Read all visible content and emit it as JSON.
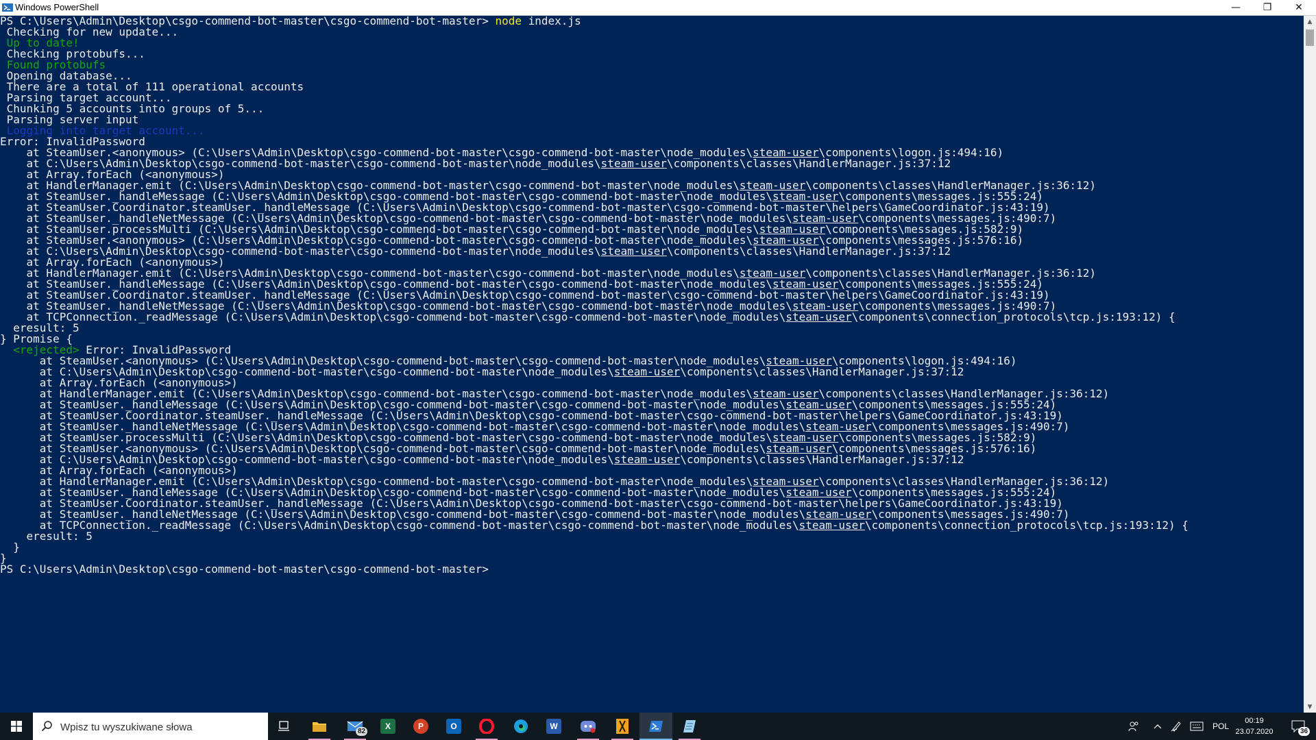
{
  "window": {
    "title": "Windows PowerShell",
    "controls": {
      "minimize": "—",
      "restore": "❐",
      "close": "✕"
    }
  },
  "console": {
    "lines": [
      [
        {
          "t": "PS C:\\Users\\Admin\\Desktop\\csgo-commend-bot-master\\csgo-commend-bot-master> ",
          "c": "gray"
        },
        {
          "t": "node",
          "c": "yellow"
        },
        {
          "t": " index.js",
          "c": "gray"
        }
      ],
      [
        {
          "t": " Checking for new update...",
          "c": "gray"
        }
      ],
      [
        {
          "t": " Up to date!",
          "c": "green"
        }
      ],
      [
        {
          "t": " Checking protobufs...",
          "c": "gray"
        }
      ],
      [
        {
          "t": " Found protobufs",
          "c": "green"
        }
      ],
      [
        {
          "t": " Opening database...",
          "c": "gray"
        }
      ],
      [
        {
          "t": " There are a total of 111 operational accounts",
          "c": "gray"
        }
      ],
      [
        {
          "t": " Parsing target account...",
          "c": "gray"
        }
      ],
      [
        {
          "t": " Chunking 5 accounts into groups of 5...",
          "c": "gray"
        }
      ],
      [
        {
          "t": " Parsing server input",
          "c": "gray"
        }
      ],
      [
        {
          "t": " Logging into target account...",
          "c": "blue"
        }
      ],
      [
        {
          "t": "Error: InvalidPassword",
          "c": "gray"
        }
      ],
      [
        {
          "t": "    at SteamUser.<anonymous> (C:\\Users\\Admin\\Desktop\\csgo-commend-bot-master\\csgo-commend-bot-master\\node_modules\\",
          "c": "gray"
        },
        {
          "t": "steam-user",
          "c": "gray",
          "u": true
        },
        {
          "t": "\\components\\logon.js:494:16)",
          "c": "gray"
        }
      ],
      [
        {
          "t": "    at C:\\Users\\Admin\\Desktop\\csgo-commend-bot-master\\csgo-commend-bot-master\\node_modules\\",
          "c": "gray"
        },
        {
          "t": "steam-user",
          "c": "gray",
          "u": true
        },
        {
          "t": "\\components\\classes\\HandlerManager.js:37:12",
          "c": "gray"
        }
      ],
      [
        {
          "t": "    at Array.forEach (<anonymous>)",
          "c": "gray"
        }
      ],
      [
        {
          "t": "    at HandlerManager.emit (C:\\Users\\Admin\\Desktop\\csgo-commend-bot-master\\csgo-commend-bot-master\\node_modules\\",
          "c": "gray"
        },
        {
          "t": "steam-user",
          "c": "gray",
          "u": true
        },
        {
          "t": "\\components\\classes\\HandlerManager.js:36:12)",
          "c": "gray"
        }
      ],
      [
        {
          "t": "    at SteamUser._handleMessage (C:\\Users\\Admin\\Desktop\\csgo-commend-bot-master\\csgo-commend-bot-master\\node_modules\\",
          "c": "gray"
        },
        {
          "t": "steam-user",
          "c": "gray",
          "u": true
        },
        {
          "t": "\\components\\messages.js:555:24)",
          "c": "gray"
        }
      ],
      [
        {
          "t": "    at SteamUser.Coordinator.steamUser._handleMessage (C:\\Users\\Admin\\Desktop\\csgo-commend-bot-master\\csgo-commend-bot-master\\helpers\\GameCoordinator.js:43:19)",
          "c": "gray"
        }
      ],
      [
        {
          "t": "    at SteamUser._handleNetMessage (C:\\Users\\Admin\\Desktop\\csgo-commend-bot-master\\csgo-commend-bot-master\\node_modules\\",
          "c": "gray"
        },
        {
          "t": "steam-user",
          "c": "gray",
          "u": true
        },
        {
          "t": "\\components\\messages.js:490:7)",
          "c": "gray"
        }
      ],
      [
        {
          "t": "    at SteamUser.processMulti (C:\\Users\\Admin\\Desktop\\csgo-commend-bot-master\\csgo-commend-bot-master\\node_modules\\",
          "c": "gray"
        },
        {
          "t": "steam-user",
          "c": "gray",
          "u": true
        },
        {
          "t": "\\components\\messages.js:582:9)",
          "c": "gray"
        }
      ],
      [
        {
          "t": "    at SteamUser.<anonymous> (C:\\Users\\Admin\\Desktop\\csgo-commend-bot-master\\csgo-commend-bot-master\\node_modules\\",
          "c": "gray"
        },
        {
          "t": "steam-user",
          "c": "gray",
          "u": true
        },
        {
          "t": "\\components\\messages.js:576:16)",
          "c": "gray"
        }
      ],
      [
        {
          "t": "    at C:\\Users\\Admin\\Desktop\\csgo-commend-bot-master\\csgo-commend-bot-master\\node_modules\\",
          "c": "gray"
        },
        {
          "t": "steam-user",
          "c": "gray",
          "u": true
        },
        {
          "t": "\\components\\classes\\HandlerManager.js:37:12",
          "c": "gray"
        }
      ],
      [
        {
          "t": "    at Array.forEach (<anonymous>)",
          "c": "gray"
        }
      ],
      [
        {
          "t": "    at HandlerManager.emit (C:\\Users\\Admin\\Desktop\\csgo-commend-bot-master\\csgo-commend-bot-master\\node_modules\\",
          "c": "gray"
        },
        {
          "t": "steam-user",
          "c": "gray",
          "u": true
        },
        {
          "t": "\\components\\classes\\HandlerManager.js:36:12)",
          "c": "gray"
        }
      ],
      [
        {
          "t": "    at SteamUser._handleMessage (C:\\Users\\Admin\\Desktop\\csgo-commend-bot-master\\csgo-commend-bot-master\\node_modules\\",
          "c": "gray"
        },
        {
          "t": "steam-user",
          "c": "gray",
          "u": true
        },
        {
          "t": "\\components\\messages.js:555:24)",
          "c": "gray"
        }
      ],
      [
        {
          "t": "    at SteamUser.Coordinator.steamUser._handleMessage (C:\\Users\\Admin\\Desktop\\csgo-commend-bot-master\\csgo-commend-bot-master\\helpers\\GameCoordinator.js:43:19)",
          "c": "gray"
        }
      ],
      [
        {
          "t": "    at SteamUser._handleNetMessage (C:\\Users\\Admin\\Desktop\\csgo-commend-bot-master\\csgo-commend-bot-master\\node_modules\\",
          "c": "gray"
        },
        {
          "t": "steam-user",
          "c": "gray",
          "u": true
        },
        {
          "t": "\\components\\messages.js:490:7)",
          "c": "gray"
        }
      ],
      [
        {
          "t": "    at TCPConnection._readMessage (C:\\Users\\Admin\\Desktop\\csgo-commend-bot-master\\csgo-commend-bot-master\\node_modules\\",
          "c": "gray"
        },
        {
          "t": "steam-user",
          "c": "gray",
          "u": true
        },
        {
          "t": "\\components\\connection_protocols\\tcp.js:193:12) {",
          "c": "gray"
        }
      ],
      [
        {
          "t": "  eresult: 5",
          "c": "gray"
        }
      ],
      [
        {
          "t": "} Promise {",
          "c": "gray"
        }
      ],
      [
        {
          "t": "  ",
          "c": "gray"
        },
        {
          "t": "<rejected>",
          "c": "green"
        },
        {
          "t": " Error: InvalidPassword",
          "c": "gray"
        }
      ],
      [
        {
          "t": "      at SteamUser.<anonymous> (C:\\Users\\Admin\\Desktop\\csgo-commend-bot-master\\csgo-commend-bot-master\\node_modules\\",
          "c": "gray"
        },
        {
          "t": "steam-user",
          "c": "gray",
          "u": true
        },
        {
          "t": "\\components\\logon.js:494:16)",
          "c": "gray"
        }
      ],
      [
        {
          "t": "      at C:\\Users\\Admin\\Desktop\\csgo-commend-bot-master\\csgo-commend-bot-master\\node_modules\\",
          "c": "gray"
        },
        {
          "t": "steam-user",
          "c": "gray",
          "u": true
        },
        {
          "t": "\\components\\classes\\HandlerManager.js:37:12",
          "c": "gray"
        }
      ],
      [
        {
          "t": "      at Array.forEach (<anonymous>)",
          "c": "gray"
        }
      ],
      [
        {
          "t": "      at HandlerManager.emit (C:\\Users\\Admin\\Desktop\\csgo-commend-bot-master\\csgo-commend-bot-master\\node_modules\\",
          "c": "gray"
        },
        {
          "t": "steam-user",
          "c": "gray",
          "u": true
        },
        {
          "t": "\\components\\classes\\HandlerManager.js:36:12)",
          "c": "gray"
        }
      ],
      [
        {
          "t": "      at SteamUser._handleMessage (C:\\Users\\Admin\\Desktop\\csgo-commend-bot-master\\csgo-commend-bot-master\\node_modules\\",
          "c": "gray"
        },
        {
          "t": "steam-user",
          "c": "gray",
          "u": true
        },
        {
          "t": "\\components\\messages.js:555:24)",
          "c": "gray"
        }
      ],
      [
        {
          "t": "      at SteamUser.Coordinator.steamUser._handleMessage (C:\\Users\\Admin\\Desktop\\csgo-commend-bot-master\\csgo-commend-bot-master\\helpers\\GameCoordinator.js:43:19)",
          "c": "gray"
        }
      ],
      [
        {
          "t": "      at SteamUser._handleNetMessage (C:\\Users\\Admin\\Desktop\\csgo-commend-bot-master\\csgo-commend-bot-master\\node_modules\\",
          "c": "gray"
        },
        {
          "t": "steam-user",
          "c": "gray",
          "u": true
        },
        {
          "t": "\\components\\messages.js:490:7)",
          "c": "gray"
        }
      ],
      [
        {
          "t": "      at SteamUser.processMulti (C:\\Users\\Admin\\Desktop\\csgo-commend-bot-master\\csgo-commend-bot-master\\node_modules\\",
          "c": "gray"
        },
        {
          "t": "steam-user",
          "c": "gray",
          "u": true
        },
        {
          "t": "\\components\\messages.js:582:9)",
          "c": "gray"
        }
      ],
      [
        {
          "t": "      at SteamUser.<anonymous> (C:\\Users\\Admin\\Desktop\\csgo-commend-bot-master\\csgo-commend-bot-master\\node_modules\\",
          "c": "gray"
        },
        {
          "t": "steam-user",
          "c": "gray",
          "u": true
        },
        {
          "t": "\\components\\messages.js:576:16)",
          "c": "gray"
        }
      ],
      [
        {
          "t": "      at C:\\Users\\Admin\\Desktop\\csgo-commend-bot-master\\csgo-commend-bot-master\\node_modules\\",
          "c": "gray"
        },
        {
          "t": "steam-user",
          "c": "gray",
          "u": true
        },
        {
          "t": "\\components\\classes\\HandlerManager.js:37:12",
          "c": "gray"
        }
      ],
      [
        {
          "t": "      at Array.forEach (<anonymous>)",
          "c": "gray"
        }
      ],
      [
        {
          "t": "      at HandlerManager.emit (C:\\Users\\Admin\\Desktop\\csgo-commend-bot-master\\csgo-commend-bot-master\\node_modules\\",
          "c": "gray"
        },
        {
          "t": "steam-user",
          "c": "gray",
          "u": true
        },
        {
          "t": "\\components\\classes\\HandlerManager.js:36:12)",
          "c": "gray"
        }
      ],
      [
        {
          "t": "      at SteamUser._handleMessage (C:\\Users\\Admin\\Desktop\\csgo-commend-bot-master\\csgo-commend-bot-master\\node_modules\\",
          "c": "gray"
        },
        {
          "t": "steam-user",
          "c": "gray",
          "u": true
        },
        {
          "t": "\\components\\messages.js:555:24)",
          "c": "gray"
        }
      ],
      [
        {
          "t": "      at SteamUser.Coordinator.steamUser._handleMessage (C:\\Users\\Admin\\Desktop\\csgo-commend-bot-master\\csgo-commend-bot-master\\helpers\\GameCoordinator.js:43:19)",
          "c": "gray"
        }
      ],
      [
        {
          "t": "      at SteamUser._handleNetMessage (C:\\Users\\Admin\\Desktop\\csgo-commend-bot-master\\csgo-commend-bot-master\\node_modules\\",
          "c": "gray"
        },
        {
          "t": "steam-user",
          "c": "gray",
          "u": true
        },
        {
          "t": "\\components\\messages.js:490:7)",
          "c": "gray"
        }
      ],
      [
        {
          "t": "      at TCPConnection._readMessage (C:\\Users\\Admin\\Desktop\\csgo-commend-bot-master\\csgo-commend-bot-master\\node_modules\\",
          "c": "gray"
        },
        {
          "t": "steam-user",
          "c": "gray",
          "u": true
        },
        {
          "t": "\\components\\connection_protocols\\tcp.js:193:12) {",
          "c": "gray"
        }
      ],
      [
        {
          "t": "    eresult: 5",
          "c": "gray"
        }
      ],
      [
        {
          "t": "  }",
          "c": "gray"
        }
      ],
      [
        {
          "t": "}",
          "c": "gray"
        }
      ],
      [
        {
          "t": "PS C:\\Users\\Admin\\Desktop\\csgo-commend-bot-master\\csgo-commend-bot-master>",
          "c": "gray"
        }
      ]
    ]
  },
  "colors": {
    "background": "#012456",
    "text": "#ededed",
    "yellow": "#eded22",
    "green": "#11a80a",
    "blue": "#1c37c0"
  },
  "taskbar": {
    "search_placeholder": "Wpisz tu wyszukiwane słowa",
    "mail_badge": "82",
    "apps": [
      "task-view-icon",
      "file-explorer-icon",
      "mail-icon",
      "excel-icon",
      "powerpoint-icon",
      "outlook-icon",
      "opera-icon",
      "edge-icon",
      "word-icon",
      "discord-icon",
      "kalkulator-icon",
      "powershell-icon",
      "notepad-icon"
    ],
    "tray": {
      "language": "POL",
      "time": "00:19",
      "date": "23.07.2020",
      "notifications": "36"
    }
  }
}
